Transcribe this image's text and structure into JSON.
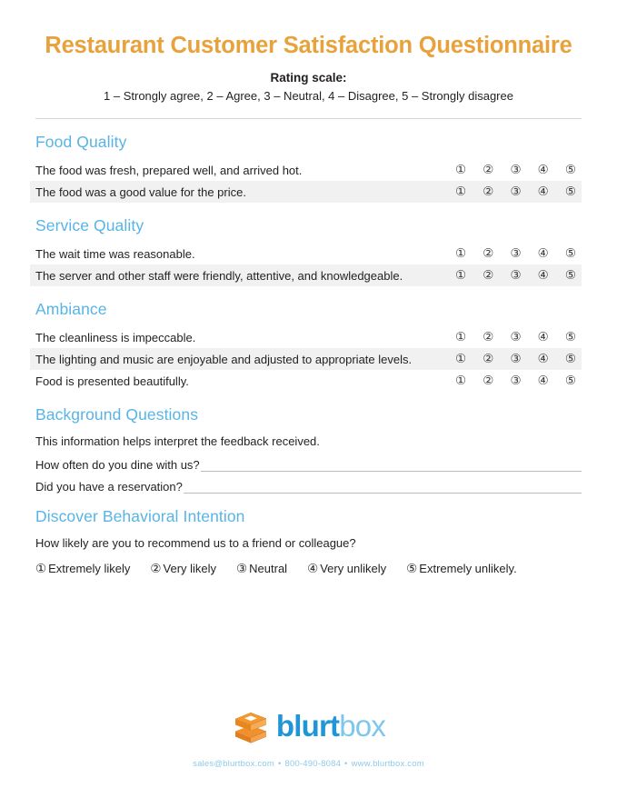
{
  "document": {
    "title": "Restaurant Customer Satisfaction Questionnaire",
    "rating_scale_label": "Rating scale:",
    "rating_scale_values": "1 – Strongly agree, 2 – Agree, 3 – Neutral, 4 – Disagree, 5 – Strongly disagree"
  },
  "scale_marks": [
    "①",
    "②",
    "③",
    "④",
    "⑤"
  ],
  "sections": [
    {
      "heading": "Food Quality",
      "questions": [
        {
          "text": "The food was fresh, prepared well, and arrived hot."
        },
        {
          "text": "The food was a good value for the price."
        }
      ]
    },
    {
      "heading": "Service Quality",
      "questions": [
        {
          "text": "The wait time was reasonable."
        },
        {
          "text": "The server and other staff were friendly, attentive, and knowledgeable."
        }
      ]
    },
    {
      "heading": "Ambiance",
      "questions": [
        {
          "text": "The cleanliness is impeccable."
        },
        {
          "text": "The lighting and music are enjoyable and adjusted to appropriate levels."
        },
        {
          "text": "Food is presented beautifully."
        }
      ]
    }
  ],
  "background": {
    "heading": "Background Questions",
    "intro": "This information helps interpret the feedback received.",
    "fields": [
      {
        "label": "How often do you dine with us?",
        "value": ""
      },
      {
        "label": "Did you have a reservation?",
        "value": ""
      }
    ]
  },
  "behavioral": {
    "heading": "Discover Behavioral Intention",
    "question": "How likely are you to recommend us to a friend or colleague?",
    "options": [
      {
        "mark": "①",
        "label": "Extremely likely"
      },
      {
        "mark": "②",
        "label": "Very likely"
      },
      {
        "mark": "③",
        "label": "Neutral"
      },
      {
        "mark": "④",
        "label": "Very unlikely"
      },
      {
        "mark": "⑤",
        "label": "Extremely unlikely."
      }
    ]
  },
  "footer": {
    "logo_bold": "blurt",
    "logo_light": "box",
    "email": "sales@blurtbox.com",
    "phone": "800-490-8084",
    "website": "www.blurtbox.com",
    "separator": "•"
  },
  "colors": {
    "title_orange": "#e8a23c",
    "heading_blue": "#58b4e5",
    "logo_blue": "#2196d6",
    "logo_blue_light": "#7ec6ec",
    "logo_orange": "#f0912d",
    "stripe_gray": "#f1f1f2",
    "rule_gray": "#d8d8d8",
    "body_text": "#231f20"
  }
}
